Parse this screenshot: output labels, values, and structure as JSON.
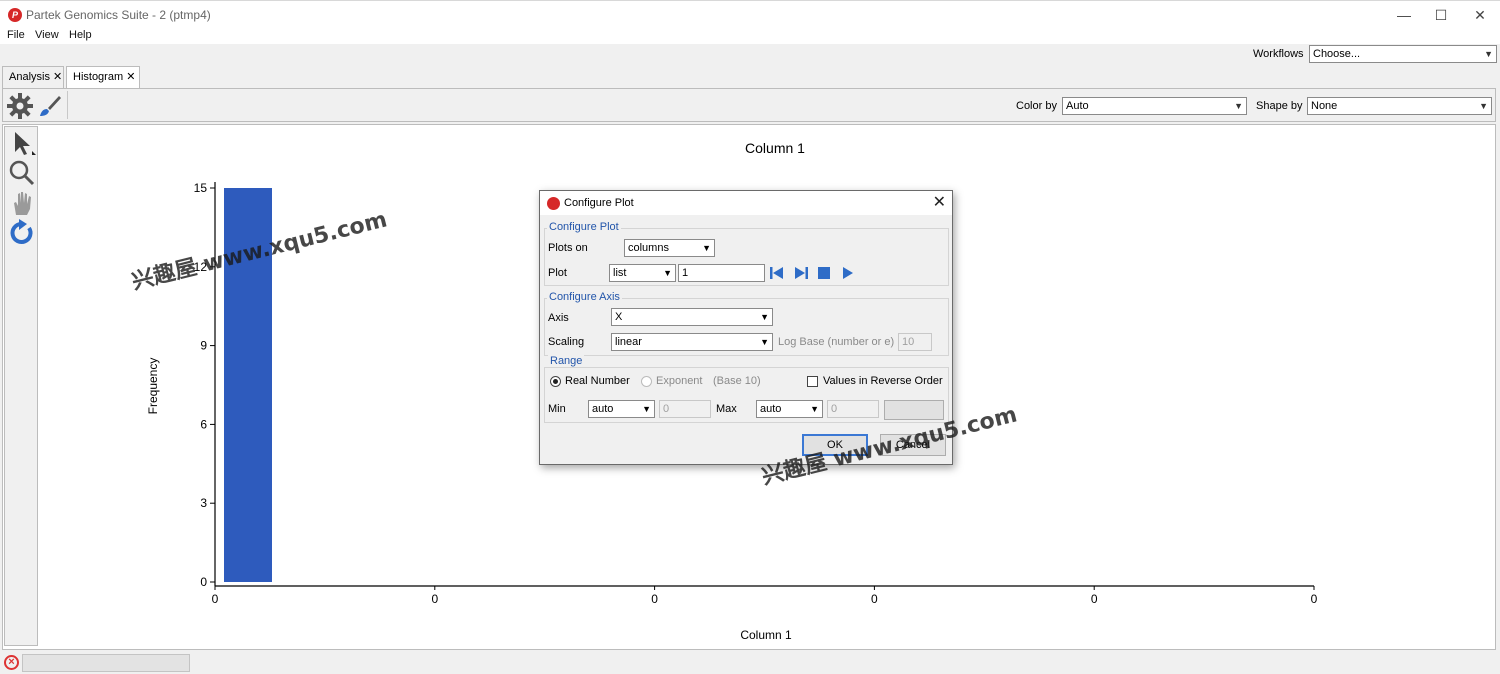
{
  "window": {
    "title": "Partek Genomics Suite - 2 (ptmp4)",
    "minimize": "—",
    "maximize": "☐",
    "close": "✕"
  },
  "menu": [
    "File",
    "View",
    "Help"
  ],
  "workflows": {
    "label": "Workflows",
    "value": "Choose..."
  },
  "tabs": [
    {
      "label": "Analysis",
      "close": "✕"
    },
    {
      "label": "Histogram",
      "close": "✕"
    }
  ],
  "toolbar": {
    "color_by_label": "Color by",
    "color_by_value": "Auto",
    "shape_by_label": "Shape by",
    "shape_by_value": "None",
    "icons": [
      "gear-icon",
      "paintbrush-icon"
    ]
  },
  "left_tools": [
    "pointer-icon",
    "zoom-icon",
    "pan-hand-icon",
    "reset-icon"
  ],
  "chart_data": {
    "type": "bar",
    "title": "Column 1",
    "xlabel": "Column 1",
    "ylabel": "Frequency",
    "x_tick_labels": [
      "0",
      "0",
      "0",
      "0",
      "0",
      "0"
    ],
    "y_ticks": [
      "0",
      "3",
      "6",
      "9",
      "12",
      "15"
    ],
    "ylim": [
      0,
      15
    ],
    "bars": [
      {
        "bin": 0,
        "value": 15
      }
    ],
    "bar_color": "#2e5bbd",
    "grid": false
  },
  "dialog": {
    "title": "Configure Plot",
    "close": "✕",
    "configure_plot": {
      "header": "Configure Plot",
      "plots_on_label": "Plots on",
      "plots_on_value": "columns",
      "plot_label": "Plot",
      "plot_mode": "list",
      "plot_value": "1"
    },
    "configure_axis": {
      "header": "Configure Axis",
      "axis_label": "Axis",
      "axis_value": "X",
      "scaling_label": "Scaling",
      "scaling_value": "linear",
      "log_base_label": "Log Base (number or e)",
      "log_base_value": "10"
    },
    "range": {
      "header": "Range",
      "real_number": "Real Number",
      "exponent": "Exponent",
      "base_note": "(Base 10)",
      "reverse_order": "Values in Reverse Order",
      "min_label": "Min",
      "min_mode": "auto",
      "min_value": "0",
      "max_label": "Max",
      "max_mode": "auto",
      "max_value": "0"
    },
    "ok": "OK",
    "cancel": "Cancel"
  },
  "watermarks": [
    "兴趣屋 www.xqu5.com",
    "兴趣屋 www.xqu5.com"
  ],
  "status": {
    "icon": "error-icon"
  }
}
